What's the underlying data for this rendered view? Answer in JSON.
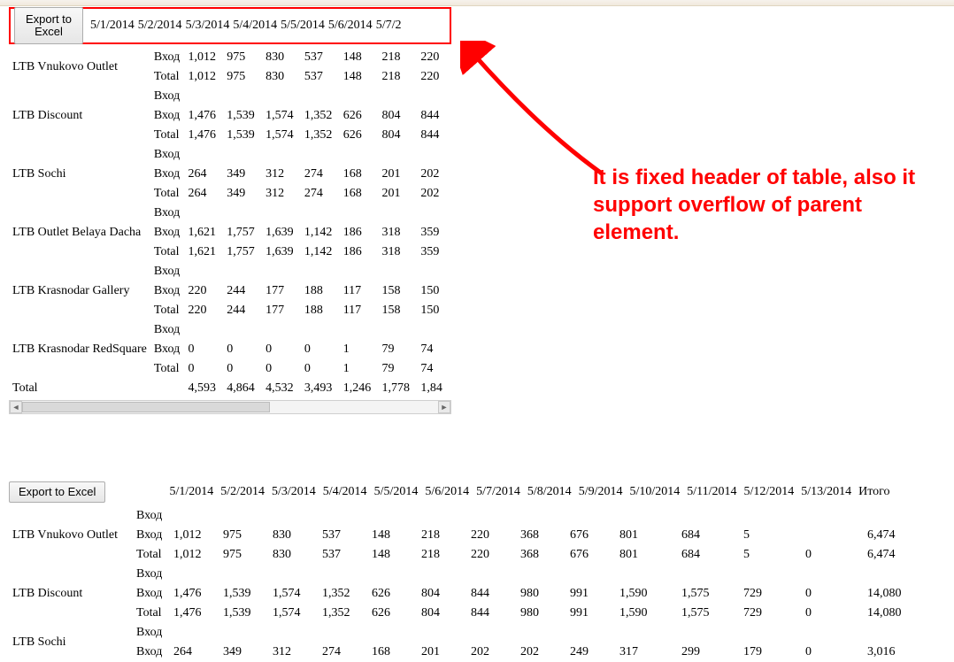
{
  "toolbar": {
    "export_label": "Export to\nExcel",
    "export_label_flat": "Export to Excel"
  },
  "header": {
    "dates": [
      "5/1/2014",
      "5/2/2014",
      "5/3/2014",
      "5/4/2014",
      "5/5/2014",
      "5/6/2014",
      "5/7/2"
    ]
  },
  "annotation": "It is fixed header of table, also it support overflow of parent element.",
  "grid1": {
    "rows": [
      {
        "name": "LTB Vnukovo Outlet",
        "lines": [
          {
            "k": "Вход",
            "v": [
              "1,012",
              "975",
              "830",
              "537",
              "148",
              "218",
              "220"
            ]
          },
          {
            "k": "Total",
            "v": [
              "1,012",
              "975",
              "830",
              "537",
              "148",
              "218",
              "220"
            ]
          }
        ]
      },
      {
        "name": "LTB Discount",
        "lines": [
          {
            "k": "Вход",
            "v": [
              "",
              "",
              "",
              "",
              "",
              "",
              ""
            ]
          },
          {
            "k": "Вход",
            "v": [
              "1,476",
              "1,539",
              "1,574",
              "1,352",
              "626",
              "804",
              "844"
            ]
          },
          {
            "k": "Total",
            "v": [
              "1,476",
              "1,539",
              "1,574",
              "1,352",
              "626",
              "804",
              "844"
            ]
          }
        ]
      },
      {
        "name": "LTB Sochi",
        "lines": [
          {
            "k": "Вход",
            "v": [
              "",
              "",
              "",
              "",
              "",
              "",
              ""
            ]
          },
          {
            "k": "Вход",
            "v": [
              "264",
              "349",
              "312",
              "274",
              "168",
              "201",
              "202"
            ]
          },
          {
            "k": "Total",
            "v": [
              "264",
              "349",
              "312",
              "274",
              "168",
              "201",
              "202"
            ]
          }
        ]
      },
      {
        "name": "LTB Outlet Belaya Dacha",
        "lines": [
          {
            "k": "Вход",
            "v": [
              "",
              "",
              "",
              "",
              "",
              "",
              ""
            ]
          },
          {
            "k": "Вход",
            "v": [
              "1,621",
              "1,757",
              "1,639",
              "1,142",
              "186",
              "318",
              "359"
            ]
          },
          {
            "k": "Total",
            "v": [
              "1,621",
              "1,757",
              "1,639",
              "1,142",
              "186",
              "318",
              "359"
            ]
          }
        ]
      },
      {
        "name": "LTB Krasnodar Gallery",
        "lines": [
          {
            "k": "Вход",
            "v": [
              "",
              "",
              "",
              "",
              "",
              "",
              ""
            ]
          },
          {
            "k": "Вход",
            "v": [
              "220",
              "244",
              "177",
              "188",
              "117",
              "158",
              "150"
            ]
          },
          {
            "k": "Total",
            "v": [
              "220",
              "244",
              "177",
              "188",
              "117",
              "158",
              "150"
            ]
          }
        ]
      },
      {
        "name": "LTB Krasnodar RedSquare",
        "lines": [
          {
            "k": "Вход",
            "v": [
              "",
              "",
              "",
              "",
              "",
              "",
              ""
            ]
          },
          {
            "k": "Вход",
            "v": [
              "0",
              "0",
              "0",
              "0",
              "1",
              "79",
              "74"
            ]
          },
          {
            "k": "Total",
            "v": [
              "0",
              "0",
              "0",
              "0",
              "1",
              "79",
              "74"
            ]
          }
        ]
      }
    ],
    "total": {
      "label": "Total",
      "v": [
        "4,593",
        "4,864",
        "4,532",
        "3,493",
        "1,246",
        "1,778",
        "1,84"
      ]
    }
  },
  "grid2": {
    "dates": [
      "5/1/2014",
      "5/2/2014",
      "5/3/2014",
      "5/4/2014",
      "5/5/2014",
      "5/6/2014",
      "5/7/2014",
      "5/8/2014",
      "5/9/2014",
      "5/10/2014",
      "5/11/2014",
      "5/12/2014",
      "5/13/2014",
      "Итого"
    ],
    "rows": [
      {
        "name": "LTB Vnukovo Outlet",
        "lines": [
          {
            "k": "Вход",
            "v": [
              "",
              "",
              "",
              "",
              "",
              "",
              "",
              "",
              "",
              "",
              "",
              "",
              "",
              ""
            ]
          },
          {
            "k": "Вход",
            "v": [
              "1,012",
              "975",
              "830",
              "537",
              "148",
              "218",
              "220",
              "368",
              "676",
              "801",
              "684",
              "5",
              "",
              "6,474"
            ]
          },
          {
            "k": "Total",
            "v": [
              "1,012",
              "975",
              "830",
              "537",
              "148",
              "218",
              "220",
              "368",
              "676",
              "801",
              "684",
              "5",
              "0",
              "6,474"
            ]
          }
        ]
      },
      {
        "name": "LTB Discount",
        "lines": [
          {
            "k": "Вход",
            "v": [
              "",
              "",
              "",
              "",
              "",
              "",
              "",
              "",
              "",
              "",
              "",
              "",
              "",
              ""
            ]
          },
          {
            "k": "Вход",
            "v": [
              "1,476",
              "1,539",
              "1,574",
              "1,352",
              "626",
              "804",
              "844",
              "980",
              "991",
              "1,590",
              "1,575",
              "729",
              "0",
              "14,080"
            ]
          },
          {
            "k": "Total",
            "v": [
              "1,476",
              "1,539",
              "1,574",
              "1,352",
              "626",
              "804",
              "844",
              "980",
              "991",
              "1,590",
              "1,575",
              "729",
              "0",
              "14,080"
            ]
          }
        ]
      },
      {
        "name": "LTB Sochi",
        "lines": [
          {
            "k": "Вход",
            "v": [
              "",
              "",
              "",
              "",
              "",
              "",
              "",
              "",
              "",
              "",
              "",
              "",
              "",
              ""
            ]
          },
          {
            "k": "Вход",
            "v": [
              "264",
              "349",
              "312",
              "274",
              "168",
              "201",
              "202",
              "202",
              "249",
              "317",
              "299",
              "179",
              "0",
              "3,016"
            ]
          }
        ]
      }
    ]
  }
}
